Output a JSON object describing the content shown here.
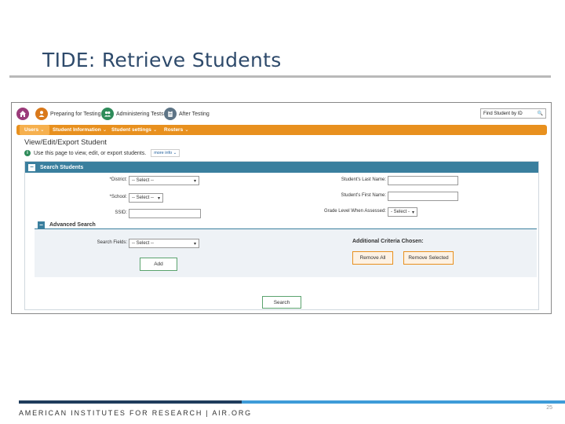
{
  "slide": {
    "title": "TIDE: Retrieve Students",
    "footer": "AMERICAN INSTITUTES FOR RESEARCH | AIR.ORG",
    "page_number": "25"
  },
  "topnav": {
    "items": [
      {
        "label": "",
        "icon": "home-icon"
      },
      {
        "label": "Preparing for Testing",
        "icon": "person-icon"
      },
      {
        "label": "Administering Tests",
        "icon": "people-icon"
      },
      {
        "label": "After Testing",
        "icon": "clipboard-icon"
      }
    ],
    "find_placeholder": "Find Student by ID"
  },
  "menu": {
    "users": "Users",
    "student_information": "Student Information",
    "student_settings": "Student settings",
    "rosters": "Rosters"
  },
  "page": {
    "heading": "View/Edit/Export Student",
    "info": "Use this page to view, edit, or export students.",
    "more_info": "more info"
  },
  "search_panel": {
    "title": "Search Students",
    "district_label": "*District:",
    "district_value": "-- Select --",
    "school_label": "*School:",
    "school_value": "-- Select --",
    "ssid_label": "SSID:",
    "last_name_label": "Student's Last Name:",
    "first_name_label": "Student's First Name:",
    "grade_label": "Grade Level When Assessed:",
    "grade_value": "- Select -"
  },
  "advanced": {
    "title": "Advanced Search",
    "fields_label": "Search Fields:",
    "fields_value": "-- Select --",
    "add_label": "Add",
    "criteria_label": "Additional Criteria Chosen:",
    "remove_all": "Remove All",
    "remove_selected": "Remove Selected"
  },
  "search_button": "Search",
  "colors": {
    "accent_orange": "#e8901e",
    "panel_teal": "#3a7f9e",
    "title_blue": "#2e4a6b",
    "footer_dark": "#1f3c5c",
    "footer_light": "#3e9bd8"
  }
}
